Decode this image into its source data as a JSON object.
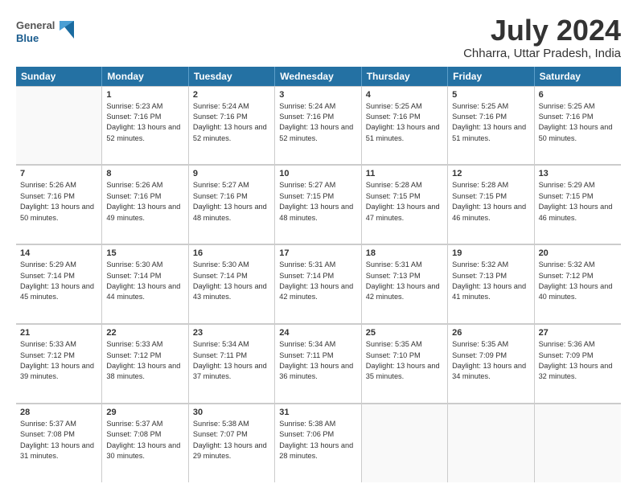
{
  "header": {
    "logo_general": "General",
    "logo_blue": "Blue",
    "title": "July 2024",
    "location": "Chharra, Uttar Pradesh, India"
  },
  "calendar": {
    "days_of_week": [
      "Sunday",
      "Monday",
      "Tuesday",
      "Wednesday",
      "Thursday",
      "Friday",
      "Saturday"
    ],
    "weeks": [
      [
        {
          "day": "",
          "empty": true
        },
        {
          "day": "1",
          "sunrise": "Sunrise: 5:23 AM",
          "sunset": "Sunset: 7:16 PM",
          "daylight": "Daylight: 13 hours and 52 minutes."
        },
        {
          "day": "2",
          "sunrise": "Sunrise: 5:24 AM",
          "sunset": "Sunset: 7:16 PM",
          "daylight": "Daylight: 13 hours and 52 minutes."
        },
        {
          "day": "3",
          "sunrise": "Sunrise: 5:24 AM",
          "sunset": "Sunset: 7:16 PM",
          "daylight": "Daylight: 13 hours and 52 minutes."
        },
        {
          "day": "4",
          "sunrise": "Sunrise: 5:25 AM",
          "sunset": "Sunset: 7:16 PM",
          "daylight": "Daylight: 13 hours and 51 minutes."
        },
        {
          "day": "5",
          "sunrise": "Sunrise: 5:25 AM",
          "sunset": "Sunset: 7:16 PM",
          "daylight": "Daylight: 13 hours and 51 minutes."
        },
        {
          "day": "6",
          "sunrise": "Sunrise: 5:25 AM",
          "sunset": "Sunset: 7:16 PM",
          "daylight": "Daylight: 13 hours and 50 minutes."
        }
      ],
      [
        {
          "day": "7",
          "sunrise": "Sunrise: 5:26 AM",
          "sunset": "Sunset: 7:16 PM",
          "daylight": "Daylight: 13 hours and 50 minutes."
        },
        {
          "day": "8",
          "sunrise": "Sunrise: 5:26 AM",
          "sunset": "Sunset: 7:16 PM",
          "daylight": "Daylight: 13 hours and 49 minutes."
        },
        {
          "day": "9",
          "sunrise": "Sunrise: 5:27 AM",
          "sunset": "Sunset: 7:16 PM",
          "daylight": "Daylight: 13 hours and 48 minutes."
        },
        {
          "day": "10",
          "sunrise": "Sunrise: 5:27 AM",
          "sunset": "Sunset: 7:15 PM",
          "daylight": "Daylight: 13 hours and 48 minutes."
        },
        {
          "day": "11",
          "sunrise": "Sunrise: 5:28 AM",
          "sunset": "Sunset: 7:15 PM",
          "daylight": "Daylight: 13 hours and 47 minutes."
        },
        {
          "day": "12",
          "sunrise": "Sunrise: 5:28 AM",
          "sunset": "Sunset: 7:15 PM",
          "daylight": "Daylight: 13 hours and 46 minutes."
        },
        {
          "day": "13",
          "sunrise": "Sunrise: 5:29 AM",
          "sunset": "Sunset: 7:15 PM",
          "daylight": "Daylight: 13 hours and 46 minutes."
        }
      ],
      [
        {
          "day": "14",
          "sunrise": "Sunrise: 5:29 AM",
          "sunset": "Sunset: 7:14 PM",
          "daylight": "Daylight: 13 hours and 45 minutes."
        },
        {
          "day": "15",
          "sunrise": "Sunrise: 5:30 AM",
          "sunset": "Sunset: 7:14 PM",
          "daylight": "Daylight: 13 hours and 44 minutes."
        },
        {
          "day": "16",
          "sunrise": "Sunrise: 5:30 AM",
          "sunset": "Sunset: 7:14 PM",
          "daylight": "Daylight: 13 hours and 43 minutes."
        },
        {
          "day": "17",
          "sunrise": "Sunrise: 5:31 AM",
          "sunset": "Sunset: 7:14 PM",
          "daylight": "Daylight: 13 hours and 42 minutes."
        },
        {
          "day": "18",
          "sunrise": "Sunrise: 5:31 AM",
          "sunset": "Sunset: 7:13 PM",
          "daylight": "Daylight: 13 hours and 42 minutes."
        },
        {
          "day": "19",
          "sunrise": "Sunrise: 5:32 AM",
          "sunset": "Sunset: 7:13 PM",
          "daylight": "Daylight: 13 hours and 41 minutes."
        },
        {
          "day": "20",
          "sunrise": "Sunrise: 5:32 AM",
          "sunset": "Sunset: 7:12 PM",
          "daylight": "Daylight: 13 hours and 40 minutes."
        }
      ],
      [
        {
          "day": "21",
          "sunrise": "Sunrise: 5:33 AM",
          "sunset": "Sunset: 7:12 PM",
          "daylight": "Daylight: 13 hours and 39 minutes."
        },
        {
          "day": "22",
          "sunrise": "Sunrise: 5:33 AM",
          "sunset": "Sunset: 7:12 PM",
          "daylight": "Daylight: 13 hours and 38 minutes."
        },
        {
          "day": "23",
          "sunrise": "Sunrise: 5:34 AM",
          "sunset": "Sunset: 7:11 PM",
          "daylight": "Daylight: 13 hours and 37 minutes."
        },
        {
          "day": "24",
          "sunrise": "Sunrise: 5:34 AM",
          "sunset": "Sunset: 7:11 PM",
          "daylight": "Daylight: 13 hours and 36 minutes."
        },
        {
          "day": "25",
          "sunrise": "Sunrise: 5:35 AM",
          "sunset": "Sunset: 7:10 PM",
          "daylight": "Daylight: 13 hours and 35 minutes."
        },
        {
          "day": "26",
          "sunrise": "Sunrise: 5:35 AM",
          "sunset": "Sunset: 7:09 PM",
          "daylight": "Daylight: 13 hours and 34 minutes."
        },
        {
          "day": "27",
          "sunrise": "Sunrise: 5:36 AM",
          "sunset": "Sunset: 7:09 PM",
          "daylight": "Daylight: 13 hours and 32 minutes."
        }
      ],
      [
        {
          "day": "28",
          "sunrise": "Sunrise: 5:37 AM",
          "sunset": "Sunset: 7:08 PM",
          "daylight": "Daylight: 13 hours and 31 minutes."
        },
        {
          "day": "29",
          "sunrise": "Sunrise: 5:37 AM",
          "sunset": "Sunset: 7:08 PM",
          "daylight": "Daylight: 13 hours and 30 minutes."
        },
        {
          "day": "30",
          "sunrise": "Sunrise: 5:38 AM",
          "sunset": "Sunset: 7:07 PM",
          "daylight": "Daylight: 13 hours and 29 minutes."
        },
        {
          "day": "31",
          "sunrise": "Sunrise: 5:38 AM",
          "sunset": "Sunset: 7:06 PM",
          "daylight": "Daylight: 13 hours and 28 minutes."
        },
        {
          "day": "",
          "empty": true
        },
        {
          "day": "",
          "empty": true
        },
        {
          "day": "",
          "empty": true
        }
      ]
    ]
  }
}
